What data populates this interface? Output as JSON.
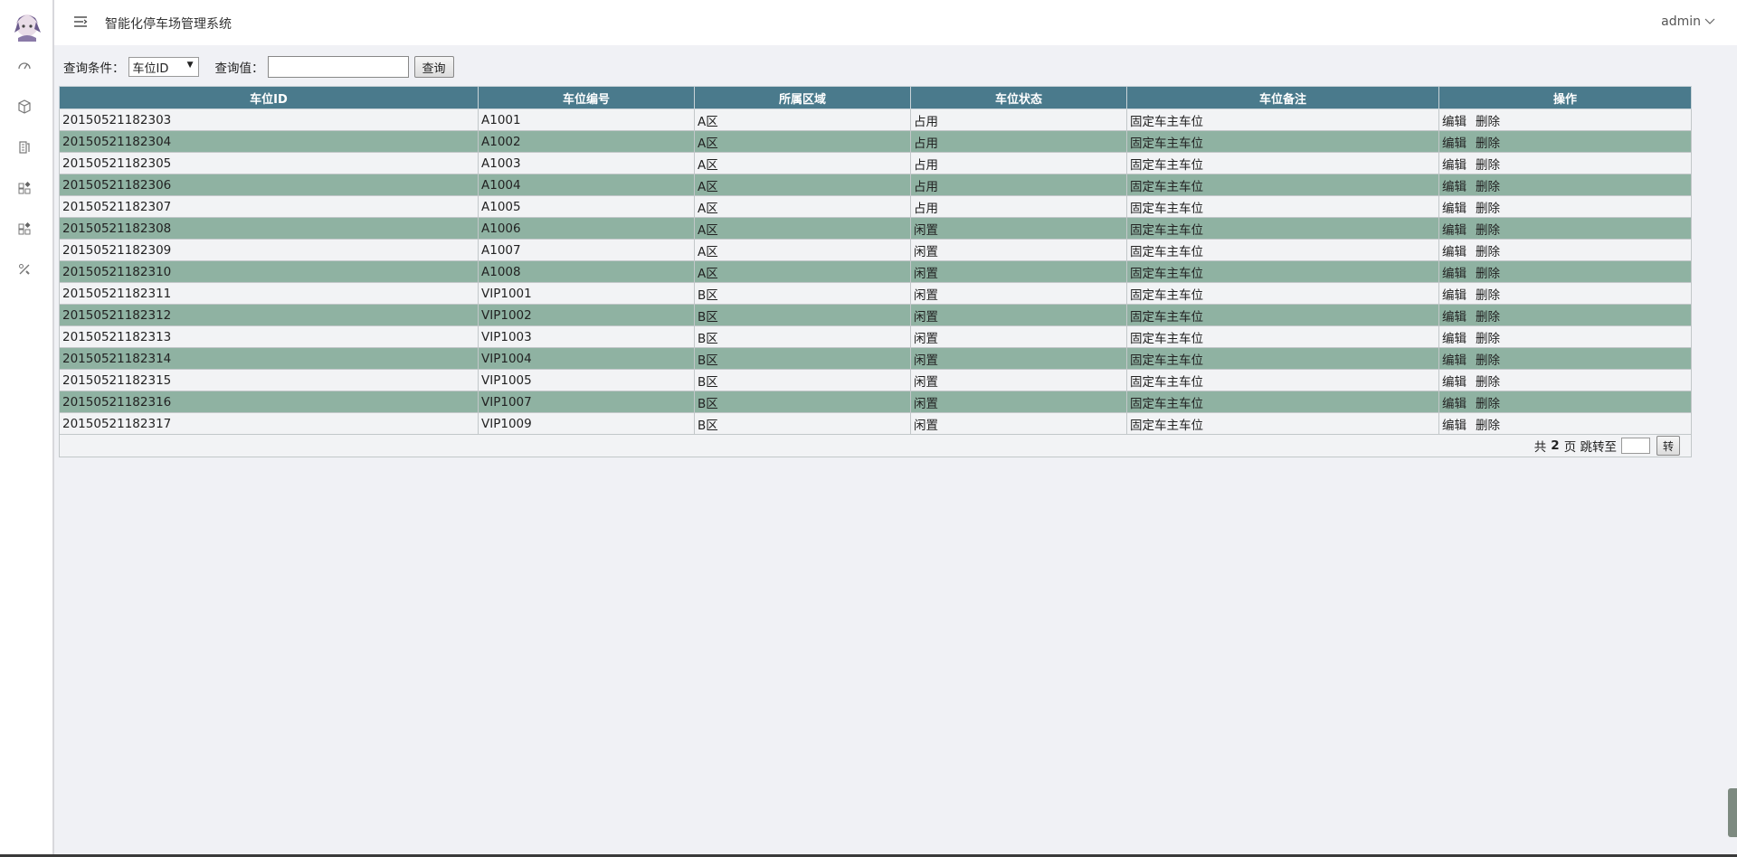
{
  "header": {
    "title": "智能化停车场管理系统",
    "user": "admin"
  },
  "sidebar": {
    "icons": [
      "dashboard-icon",
      "cube-icon",
      "document-icon",
      "apps-icon",
      "apps-icon",
      "tools-icon"
    ]
  },
  "search": {
    "condition_label": "查询条件：",
    "condition_value": "车位ID",
    "value_label": "查询值：",
    "value_text": "",
    "submit_label": "查询"
  },
  "table": {
    "columns": [
      "车位ID",
      "车位编号",
      "所属区域",
      "车位状态",
      "车位备注",
      "操作"
    ],
    "edit_label": "编辑",
    "delete_label": "删除",
    "rows": [
      {
        "id": "20150521182303",
        "code": "A1001",
        "area": "A区",
        "status": "占用",
        "note": "固定车主车位"
      },
      {
        "id": "20150521182304",
        "code": "A1002",
        "area": "A区",
        "status": "占用",
        "note": "固定车主车位"
      },
      {
        "id": "20150521182305",
        "code": "A1003",
        "area": "A区",
        "status": "占用",
        "note": "固定车主车位"
      },
      {
        "id": "20150521182306",
        "code": "A1004",
        "area": "A区",
        "status": "占用",
        "note": "固定车主车位"
      },
      {
        "id": "20150521182307",
        "code": "A1005",
        "area": "A区",
        "status": "占用",
        "note": "固定车主车位"
      },
      {
        "id": "20150521182308",
        "code": "A1006",
        "area": "A区",
        "status": "闲置",
        "note": "固定车主车位"
      },
      {
        "id": "20150521182309",
        "code": "A1007",
        "area": "A区",
        "status": "闲置",
        "note": "固定车主车位"
      },
      {
        "id": "20150521182310",
        "code": "A1008",
        "area": "A区",
        "status": "闲置",
        "note": "固定车主车位"
      },
      {
        "id": "20150521182311",
        "code": "VIP1001",
        "area": "B区",
        "status": "闲置",
        "note": "固定车主车位"
      },
      {
        "id": "20150521182312",
        "code": "VIP1002",
        "area": "B区",
        "status": "闲置",
        "note": "固定车主车位"
      },
      {
        "id": "20150521182313",
        "code": "VIP1003",
        "area": "B区",
        "status": "闲置",
        "note": "固定车主车位"
      },
      {
        "id": "20150521182314",
        "code": "VIP1004",
        "area": "B区",
        "status": "闲置",
        "note": "固定车主车位"
      },
      {
        "id": "20150521182315",
        "code": "VIP1005",
        "area": "B区",
        "status": "闲置",
        "note": "固定车主车位"
      },
      {
        "id": "20150521182316",
        "code": "VIP1007",
        "area": "B区",
        "status": "闲置",
        "note": "固定车主车位"
      },
      {
        "id": "20150521182317",
        "code": "VIP1009",
        "area": "B区",
        "status": "闲置",
        "note": "固定车主车位"
      }
    ]
  },
  "pager": {
    "prefix": "共",
    "total_pages": "2",
    "suffix": "页 跳转至",
    "jump_value": "",
    "go_label": "转"
  },
  "colors": {
    "header_bg": "#4a7a8c",
    "row_alt": "#8fb2a2",
    "row_light": "#f2f3f5"
  }
}
